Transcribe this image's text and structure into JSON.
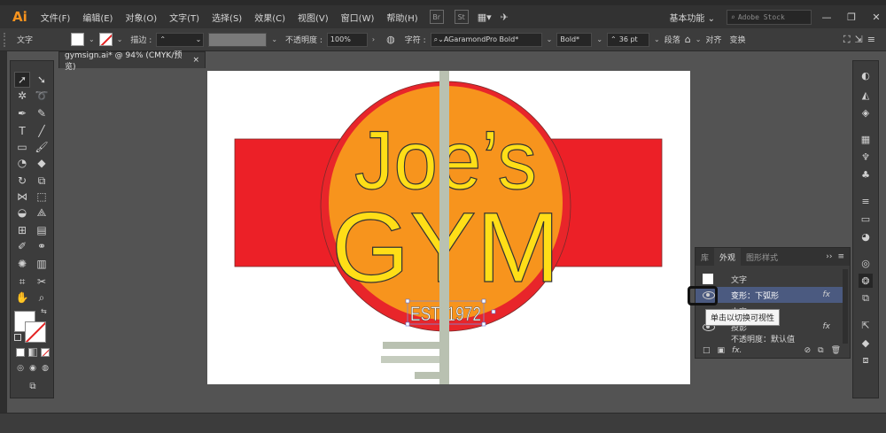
{
  "app": {
    "logo": "Ai",
    "document_tab": "gymsign.ai* @ 94% (CMYK/预览)",
    "tab_close": "×"
  },
  "menu": [
    "文件(F)",
    "编辑(E)",
    "对象(O)",
    "文字(T)",
    "选择(S)",
    "效果(C)",
    "视图(V)",
    "窗口(W)",
    "帮助(H)"
  ],
  "menubar_apps": {
    "br": "Br",
    "st": "St"
  },
  "workspace": {
    "label": "基本功能",
    "search_placeholder": "Adobe Stock"
  },
  "window_controls": {
    "minimize": "—",
    "maximize": "❐",
    "close": "✕"
  },
  "control_bar": {
    "type_label": "文字",
    "stroke_label": "描边 :",
    "opacity_label": "不透明度 :",
    "opacity_value": "100%",
    "char_label": "字符 :",
    "font_value": "AGaramondPro Bold*",
    "style_value": "Bold*",
    "size_value": "36 pt",
    "paragraph_label": "段落",
    "align_label": "对齐",
    "transform_label": "变换"
  },
  "artwork": {
    "line1": "Joe’s",
    "line2": "GYM",
    "line3": "EST. 1972",
    "colors": {
      "band": "#ec2027",
      "circle_outer": "#e8252a",
      "circle_inner": "#f7941d",
      "text_fill": "#ffde17",
      "guide": "#b9c1b1"
    }
  },
  "appearance_panel": {
    "tabs": [
      "库",
      "外观",
      "图形样式"
    ],
    "active_tab": "外观",
    "rows": [
      {
        "label": "文字",
        "fx": ""
      },
      {
        "label": "变形：下弧形",
        "fx": "fx"
      },
      {
        "label": "内容",
        "fx": ""
      },
      {
        "label": "投影",
        "fx": "fx"
      },
      {
        "label": "不透明度：默认值",
        "fx": ""
      }
    ],
    "tooltip": "单击以切换可视性",
    "footer_fx": "fx."
  }
}
